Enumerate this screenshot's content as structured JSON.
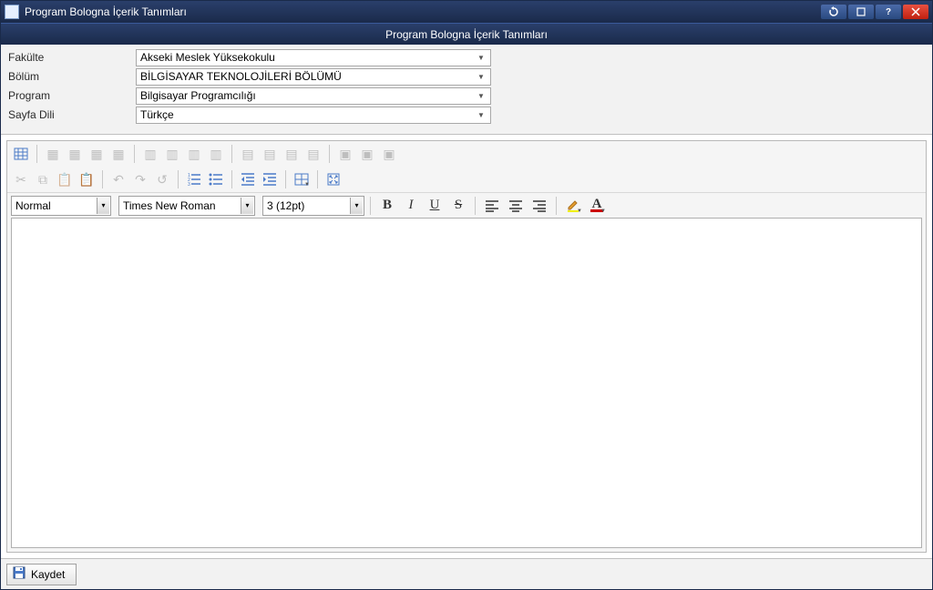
{
  "title": "Program Bologna İçerik Tanımları",
  "subtitle": "Program Bologna İçerik Tanımları",
  "form": {
    "fakulte_label": "Fakülte",
    "fakulte_value": "Akseki Meslek Yüksekokulu",
    "bolum_label": "Bölüm",
    "bolum_value": "BİLGİSAYAR TEKNOLOJİLERİ BÖLÜMÜ",
    "program_label": "Program",
    "program_value": "Bilgisayar Programcılığı",
    "dil_label": "Sayfa Dili",
    "dil_value": "Türkçe"
  },
  "editor": {
    "para_style": "Normal",
    "font_family": "Times New Roman",
    "font_size": "3 (12pt)",
    "bold": "B",
    "italic": "I",
    "underline": "U",
    "strike": "S",
    "fontcolor": "A"
  },
  "footer": {
    "save_label": "Kaydet"
  }
}
